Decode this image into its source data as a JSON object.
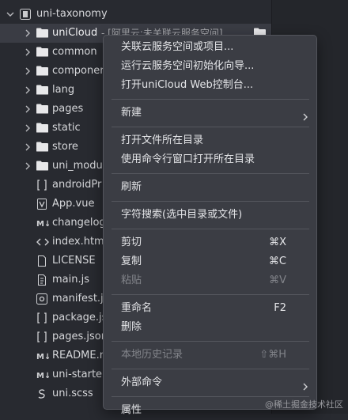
{
  "project": {
    "name": "uni-taxonomy"
  },
  "unicloud": {
    "name": "uniCloud",
    "suffix": "- [阿里云:未关联云服务空间]"
  },
  "tree_items": [
    {
      "label": "common",
      "icon": "folder-icon"
    },
    {
      "label": "componer",
      "icon": "folder-icon"
    },
    {
      "label": "lang",
      "icon": "folder-icon"
    },
    {
      "label": "pages",
      "icon": "folder-icon"
    },
    {
      "label": "static",
      "icon": "folder-icon"
    },
    {
      "label": "store",
      "icon": "folder-icon"
    },
    {
      "label": "uni_modu",
      "icon": "folder-icon"
    },
    {
      "label": "androidPr",
      "icon": "bracket-file-icon"
    },
    {
      "label": "App.vue",
      "icon": "vue-file-icon"
    },
    {
      "label": "changelog",
      "icon": "markdown-file-icon"
    },
    {
      "label": "index.htm",
      "icon": "html-file-icon"
    },
    {
      "label": "LICENSE",
      "icon": "text-file-icon"
    },
    {
      "label": "main.js",
      "icon": "js-file-icon"
    },
    {
      "label": "manifest.j",
      "icon": "manifest-file-icon"
    },
    {
      "label": "package.js",
      "icon": "bracket-file-icon"
    },
    {
      "label": "pages.json",
      "icon": "bracket-file-icon"
    },
    {
      "label": "README.m",
      "icon": "markdown-file-icon"
    },
    {
      "label": "uni-starte",
      "icon": "markdown-file-icon"
    },
    {
      "label": "uni.scss",
      "icon": "scss-file-icon"
    }
  ],
  "menu": {
    "items": [
      {
        "label": "关联云服务空间或项目..."
      },
      {
        "label": "运行云服务空间初始化向导..."
      },
      {
        "label": "打开uniCloud Web控制台..."
      },
      {
        "label": "新建",
        "submenu": true
      },
      {
        "label": "打开文件所在目录"
      },
      {
        "label": "使用命令行窗口打开所在目录"
      },
      {
        "label": "刷新"
      },
      {
        "label": "字符搜索(选中目录或文件)"
      },
      {
        "label": "剪切",
        "shortcut": "⌘X"
      },
      {
        "label": "复制",
        "shortcut": "⌘C"
      },
      {
        "label": "粘贴",
        "shortcut": "⌘V",
        "disabled": true
      },
      {
        "label": "重命名",
        "shortcut": "F2"
      },
      {
        "label": "删除"
      },
      {
        "label": "本地历史记录",
        "shortcut": "⇧⌘H",
        "disabled": true
      },
      {
        "label": "外部命令",
        "submenu": true
      },
      {
        "label": "属性"
      }
    ]
  },
  "watermark": "@稀土掘金技术社区",
  "colors": {
    "background": "#282a30",
    "menu_bg": "#3b3d44",
    "selected_row": "#3a3c44",
    "text": "#d6d7da"
  }
}
